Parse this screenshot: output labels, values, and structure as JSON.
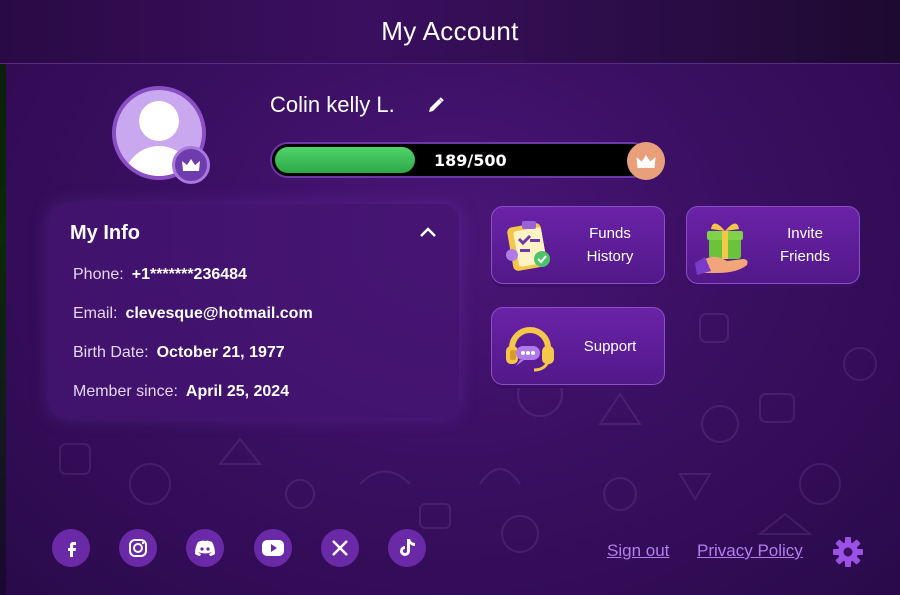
{
  "header": {
    "title": "My Account"
  },
  "profile": {
    "name": "Colin kelly L.",
    "progress_text": "189/500",
    "progress_value": 189,
    "progress_max": 500
  },
  "my_info": {
    "title": "My Info",
    "rows": [
      {
        "label": "Phone:",
        "value": "+1*******236484"
      },
      {
        "label": "Email:",
        "value": "clevesque@hotmail.com"
      },
      {
        "label": "Birth Date:",
        "value": "October 21, 1977"
      },
      {
        "label": "Member since:",
        "value": "April 25, 2024"
      }
    ]
  },
  "actions": {
    "funds_history": {
      "line1": "Funds",
      "line2": "History"
    },
    "invite_friends": {
      "line1": "Invite",
      "line2": "Friends"
    },
    "support": {
      "label": "Support"
    }
  },
  "social": [
    "facebook-icon",
    "instagram-icon",
    "discord-icon",
    "youtube-icon",
    "x-icon",
    "tiktok-icon"
  ],
  "footer": {
    "sign_out": "Sign out",
    "privacy_policy": "Privacy Policy"
  },
  "colors": {
    "accent": "#b57cf0",
    "progress_fill": "#3fbf5c",
    "crown_badge": "#e7a07a",
    "card_bg": "#521889"
  }
}
